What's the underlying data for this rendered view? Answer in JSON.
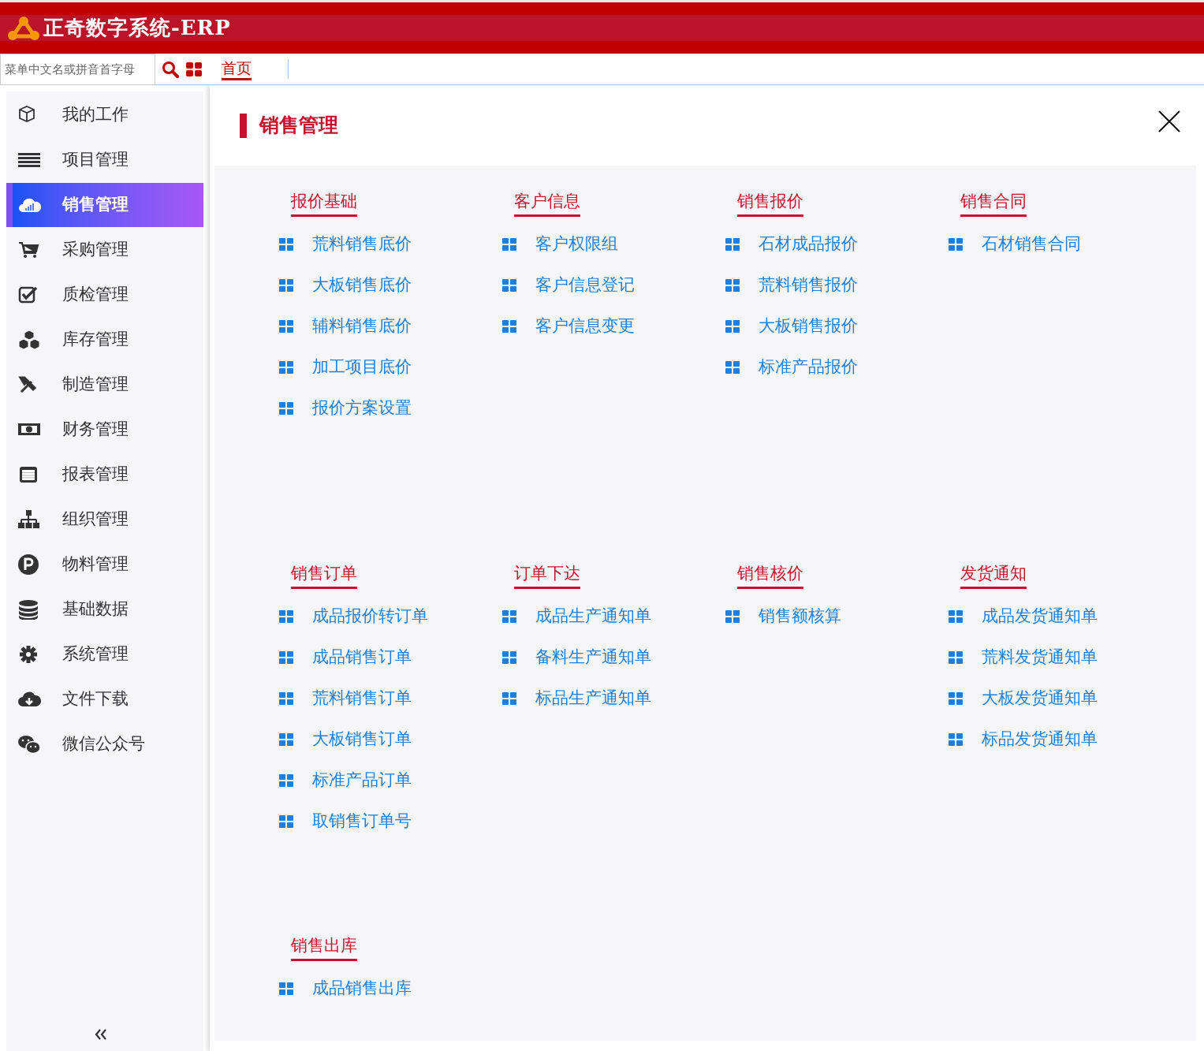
{
  "app": {
    "title": "正奇数字系统-ERP"
  },
  "search": {
    "placeholder": "菜单中文名或拼音首字母"
  },
  "tabs": [
    {
      "label": "首页",
      "selected": true
    }
  ],
  "sidebar": {
    "items": [
      {
        "label": "我的工作",
        "selected": false
      },
      {
        "label": "项目管理",
        "selected": false
      },
      {
        "label": "销售管理",
        "selected": true
      },
      {
        "label": "采购管理",
        "selected": false
      },
      {
        "label": "质检管理",
        "selected": false
      },
      {
        "label": "库存管理",
        "selected": false
      },
      {
        "label": "制造管理",
        "selected": false
      },
      {
        "label": "财务管理",
        "selected": false
      },
      {
        "label": "报表管理",
        "selected": false
      },
      {
        "label": "组织管理",
        "selected": false
      },
      {
        "label": "物料管理",
        "selected": false
      },
      {
        "label": "基础数据",
        "selected": false
      },
      {
        "label": "系统管理",
        "selected": false
      },
      {
        "label": "文件下载",
        "selected": false
      },
      {
        "label": "微信公众号",
        "selected": false
      }
    ]
  },
  "panel": {
    "title": "销售管理",
    "groups": [
      {
        "title": "报价基础",
        "items": [
          "荒料销售底价",
          "大板销售底价",
          "辅料销售底价",
          "加工项目底价",
          "报价方案设置"
        ]
      },
      {
        "title": "客户信息",
        "items": [
          "客户权限组",
          "客户信息登记",
          "客户信息变更"
        ]
      },
      {
        "title": "销售报价",
        "items": [
          "石材成品报价",
          "荒料销售报价",
          "大板销售报价",
          "标准产品报价"
        ]
      },
      {
        "title": "销售合同",
        "items": [
          "石材销售合同"
        ]
      },
      {
        "title": "销售订单",
        "items": [
          "成品报价转订单",
          "成品销售订单",
          "荒料销售订单",
          "大板销售订单",
          "标准产品订单",
          "取销售订单号"
        ]
      },
      {
        "title": "订单下达",
        "items": [
          "成品生产通知单",
          "备料生产通知单",
          "标品生产通知单"
        ]
      },
      {
        "title": "销售核价",
        "items": [
          "销售额核算"
        ]
      },
      {
        "title": "发货通知",
        "items": [
          "成品发货通知单",
          "荒料发货通知单",
          "大板发货通知单",
          "标品发货通知单"
        ]
      },
      {
        "title": "销售出库",
        "items": [
          "成品销售出库"
        ]
      }
    ]
  }
}
